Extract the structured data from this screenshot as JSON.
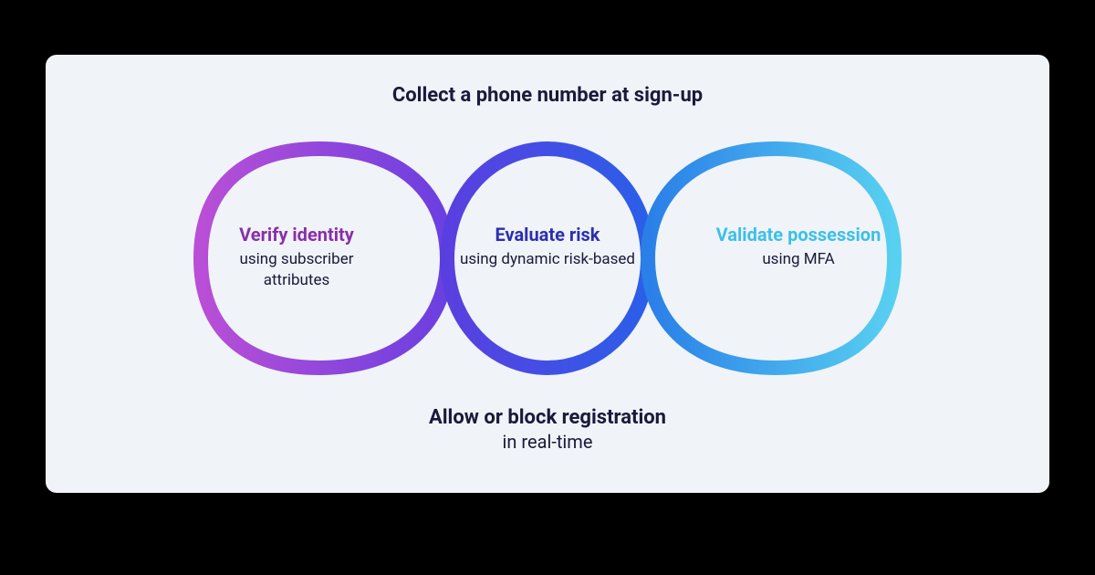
{
  "header": "Collect a phone number at sign-up",
  "nodes": {
    "left": {
      "title": "Verify identity",
      "sub": "using subscriber attributes"
    },
    "center": {
      "title": "Evaluate risk",
      "sub": "using dynamic risk-based"
    },
    "right": {
      "title": "Validate possession",
      "sub": "using MFA"
    }
  },
  "footer": {
    "title": "Allow or block registration",
    "sub": "in real-time"
  },
  "colors": {
    "purple": "#8a2fa8",
    "indigo": "#3a3fd0",
    "cyan": "#3cc0e8"
  }
}
